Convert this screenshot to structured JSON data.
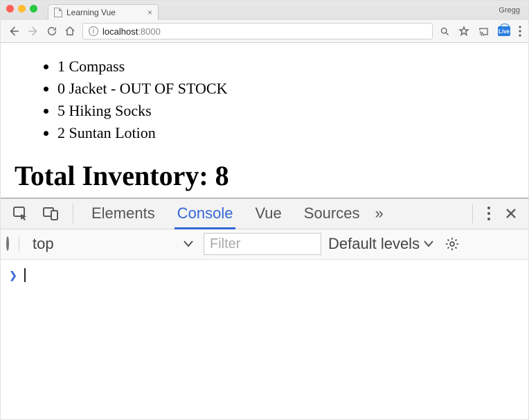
{
  "browser": {
    "tab_title": "Learning Vue",
    "profile_name": "Gregg",
    "url_host": "localhost",
    "url_port": ":8000",
    "traffic": {
      "red": "#ff5f57",
      "yellow": "#febc2e",
      "green": "#28c840"
    }
  },
  "page": {
    "items": [
      {
        "qty": 1,
        "name": "Compass",
        "out": false
      },
      {
        "qty": 0,
        "name": "Jacket",
        "out": true
      },
      {
        "qty": 5,
        "name": "Hiking Socks",
        "out": false
      },
      {
        "qty": 2,
        "name": "Suntan Lotion",
        "out": false
      }
    ],
    "out_of_stock_suffix": " - OUT OF STOCK",
    "total_label": "Total Inventory: ",
    "total_value": 8
  },
  "devtools": {
    "tabs": {
      "elements": "Elements",
      "console": "Console",
      "vue": "Vue",
      "sources": "Sources"
    },
    "overflow": "»",
    "context": "top",
    "filter_placeholder": "Filter",
    "levels": "Default levels",
    "prompt": "❯"
  }
}
